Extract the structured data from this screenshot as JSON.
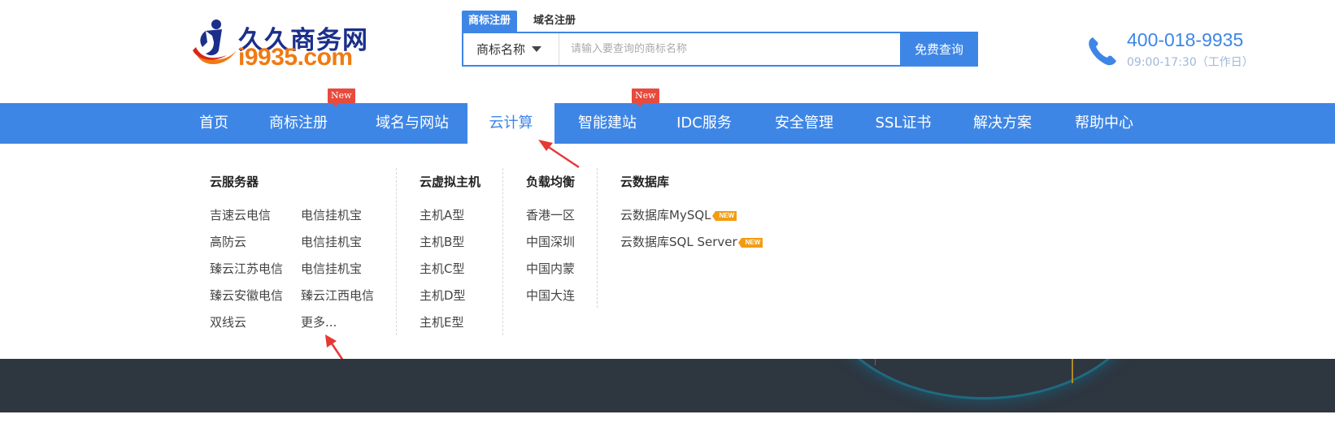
{
  "logo": {
    "name_cn": "久久商务网",
    "name_en": "i9935.com",
    "colors": {
      "blue": "#1b2f8a",
      "orange": "#f07a12",
      "red": "#d8261b"
    }
  },
  "search": {
    "tabs": [
      "商标注册",
      "域名注册"
    ],
    "select_value": "商标名称",
    "placeholder": "请输入要查询的商标名称",
    "button_label": "免费查询"
  },
  "phone": {
    "number": "400-018-9935",
    "hours": "09:00-17:30（工作日）"
  },
  "nav": {
    "items": [
      {
        "label": "首页"
      },
      {
        "label": "商标注册",
        "badge": "New"
      },
      {
        "label": "域名与网站"
      },
      {
        "label": "云计算",
        "active": true
      },
      {
        "label": "智能建站",
        "badge": "New"
      },
      {
        "label": "IDC服务"
      },
      {
        "label": "安全管理"
      },
      {
        "label": "SSL证书"
      },
      {
        "label": "解决方案"
      },
      {
        "label": "帮助中心"
      }
    ]
  },
  "dropdown": {
    "cloud_server": {
      "title": "云服务器",
      "col1": [
        "吉速云电信",
        "高防云",
        "臻云江苏电信",
        "臻云安徽电信",
        "双线云"
      ],
      "col2": [
        "电信挂机宝",
        "电信挂机宝",
        "电信挂机宝",
        "臻云江西电信",
        "更多..."
      ]
    },
    "virtual_host": {
      "title": "云虚拟主机",
      "items": [
        "主机A型",
        "主机B型",
        "主机C型",
        "主机D型",
        "主机E型"
      ]
    },
    "load_balance": {
      "title": "负载均衡",
      "items": [
        "香港一区",
        "中国深圳",
        "中国内蒙",
        "中国大连"
      ]
    },
    "cloud_db": {
      "title": "云数据库",
      "items": [
        "云数据库MySQL",
        "云数据库SQL Server"
      ],
      "new_tag": "NEW"
    }
  },
  "colors": {
    "accent": "#3e86e6",
    "badge_red": "#e84a3d",
    "new_orange": "#f39c12",
    "banner_dark": "#2e3640"
  }
}
